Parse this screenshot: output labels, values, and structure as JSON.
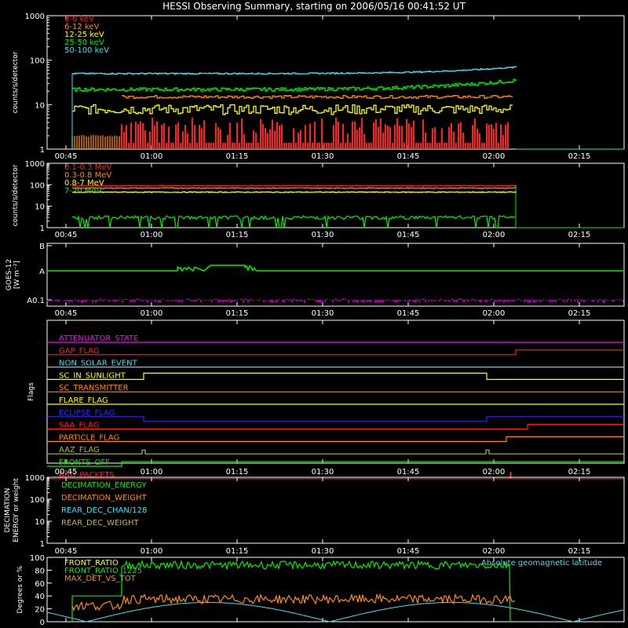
{
  "title": "HESSI Observing Summary, starting on 2006/05/16 00:41:52 UT",
  "time_axis": {
    "start": "00:41:52",
    "tick_labels": [
      "00:45",
      "01:00",
      "01:15",
      "01:30",
      "01:45",
      "02:00",
      "02:15"
    ]
  },
  "colors": {
    "red": "#ff2020",
    "orange": "#ff8c00",
    "yellow": "#ffff00",
    "green": "#00ee00",
    "cyan": "#40e0f0",
    "magenta": "#ff00ff",
    "blue": "#2a2aff",
    "olive": "#b8b83a",
    "frame": "#ffffff"
  },
  "chart_data": [
    {
      "type": "line",
      "id": "low_energy",
      "ylabel": "counts/s/detector",
      "yscale": "log",
      "ylim": [
        1,
        1000
      ],
      "y_tick_labels": [
        "1",
        "10",
        "100",
        "1000"
      ],
      "series": [
        {
          "name": "3-6 keV",
          "color": "red",
          "value": 3.5
        },
        {
          "name": "6-12 keV",
          "color": "orange",
          "value": 15
        },
        {
          "name": "12-25 keV",
          "color": "yellow",
          "value": 8
        },
        {
          "name": "25-50 keV",
          "color": "green",
          "value": 22
        },
        {
          "name": "50-100 keV",
          "color": "cyan",
          "value": 50
        }
      ]
    },
    {
      "type": "line",
      "id": "high_energy",
      "ylabel": "counts/s/detector",
      "yscale": "log",
      "ylim": [
        1,
        1000
      ],
      "y_tick_labels": [
        "1",
        "10",
        "100",
        "1000"
      ],
      "series": [
        {
          "name": "0.1-0.3 MeV",
          "color": "red",
          "value": 90
        },
        {
          "name": "0.3-0.8 MeV",
          "color": "orange",
          "value": 70
        },
        {
          "name": "0.8-7 MeV",
          "color": "yellow",
          "value": 45
        },
        {
          "name": "7-20 MeV",
          "color": "green",
          "value": 3
        }
      ]
    },
    {
      "type": "line",
      "id": "goes",
      "ylabel": "GOES-12",
      "ylabel_units": "[W m⁻²]",
      "y_tick_labels": [
        "A0.1",
        "A",
        "B"
      ],
      "series": [
        {
          "name": "goes_long",
          "color": "green",
          "level": "A"
        },
        {
          "name": "goes_short",
          "color": "magenta",
          "level": "A0.1"
        }
      ]
    },
    {
      "type": "line",
      "id": "flags",
      "ylabel": "Flags",
      "series": [
        {
          "name": "ATTENUATOR_STATE",
          "color": "magenta"
        },
        {
          "name": "GAP_FLAG",
          "color": "red"
        },
        {
          "name": "NON_SOLAR_EVENT",
          "color": "cyan"
        },
        {
          "name": "SC_IN_SUNLIGHT",
          "color": "yellow"
        },
        {
          "name": "SC_TRANSMITTER",
          "color": "orange"
        },
        {
          "name": "FLARE_FLAG",
          "color": "yellow"
        },
        {
          "name": "ECLIPSE_FLAG",
          "color": "blue"
        },
        {
          "name": "SAA_FLAG",
          "color": "red"
        },
        {
          "name": "PARTICLE_FLAG",
          "color": "orange"
        },
        {
          "name": "AAZ_FLAG",
          "color": "olive"
        },
        {
          "name": "FRONTS_OFF",
          "color": "green"
        },
        {
          "name": "BAD_PACKETS",
          "color": "red"
        }
      ]
    },
    {
      "type": "line",
      "id": "decimation",
      "ylabel": "DECIMATION",
      "ylabel2": "ENERGY or weight",
      "yscale": "log",
      "ylim": [
        1,
        1000
      ],
      "y_tick_labels": [
        "1",
        "10",
        "100",
        "1000"
      ],
      "series": [
        {
          "name": "DECIMATION_ENERGY",
          "color": "green"
        },
        {
          "name": "DECIMATION_WEIGHT",
          "color": "orange"
        },
        {
          "name": "REAR_DEC_CHAN/128",
          "color": "cyan"
        },
        {
          "name": "REAR_DEC_WEIGHT",
          "color": "olive"
        }
      ]
    },
    {
      "type": "line",
      "id": "ratios",
      "ylabel": "Degrees or %",
      "ylim": [
        0,
        100
      ],
      "y_tick_labels": [
        "0",
        "20",
        "40",
        "60",
        "80",
        "100"
      ],
      "annotation": "Absolute geomagnetic latitude",
      "series": [
        {
          "name": "FRONT_RATIO",
          "color": "yellow"
        },
        {
          "name": "FRONT_RATIO_1225",
          "color": "green",
          "value": 88
        },
        {
          "name": "MAX_DET_VS_TOT",
          "color": "orange",
          "value": 35
        },
        {
          "name": "Absolute geomagnetic latitude",
          "color": "cyan"
        }
      ]
    }
  ]
}
